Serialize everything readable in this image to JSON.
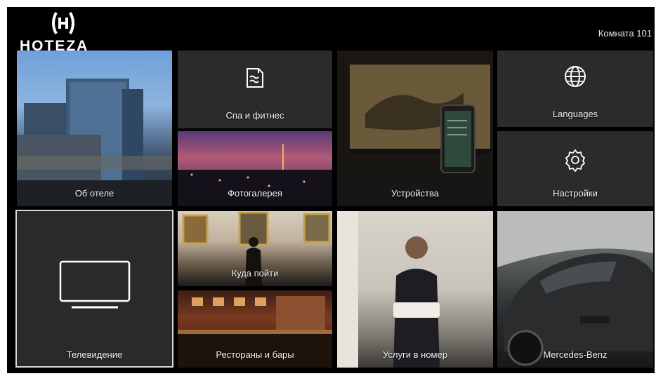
{
  "header": {
    "logo_text": "HOTEZA",
    "room_label": "Комната 101"
  },
  "tiles": {
    "hotel": {
      "label": "Об отеле"
    },
    "spa": {
      "label": "Спа и фитнес",
      "icon": "spa-icon"
    },
    "gallery": {
      "label": "Фотогалерея"
    },
    "devices": {
      "label": "Устройства"
    },
    "languages": {
      "label": "Languages",
      "icon": "globe-icon"
    },
    "settings": {
      "label": "Настройки",
      "icon": "gear-icon"
    },
    "tv": {
      "label": "Телевидение",
      "icon": "tv-icon"
    },
    "where": {
      "label": "Куда пойти"
    },
    "restaurants": {
      "label": "Рестораны и бары"
    },
    "room_service": {
      "label": "Услуги в номер"
    },
    "mercedes": {
      "label": "Mercedes-Benz"
    }
  }
}
